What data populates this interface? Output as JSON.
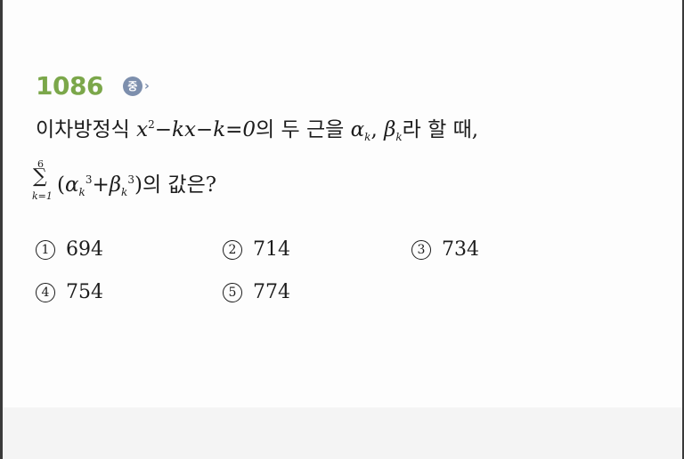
{
  "question": {
    "number": "1086",
    "difficulty": "중",
    "difficulty_arrow": "›",
    "line1": {
      "prefix": "이차방정식 ",
      "eq_x": "x",
      "eq_exp": "2",
      "eq_rest": "−kx−k=0",
      "mid": "의 두 근을 ",
      "alpha": "α",
      "k1": "k",
      "comma": ", ",
      "beta": "β",
      "k2": "k",
      "suffix": "라 할 때,"
    },
    "sigma": {
      "upper": "6",
      "symbol": "∑",
      "lower": "k=1"
    },
    "line2": {
      "open": "(",
      "alpha": "α",
      "k1": "k",
      "exp1": "3",
      "plus": "+",
      "beta": "β",
      "k2": "k",
      "exp2": "3",
      "close": ")",
      "suffix": "의 값은?"
    }
  },
  "choices": [
    {
      "marker": "1",
      "value": "694"
    },
    {
      "marker": "2",
      "value": "714"
    },
    {
      "marker": "3",
      "value": "734"
    },
    {
      "marker": "4",
      "value": "754"
    },
    {
      "marker": "5",
      "value": "774"
    }
  ],
  "colors": {
    "number_green": "#7ba74a",
    "badge_blue": "#7d8fad",
    "text": "#1c1c1c"
  }
}
